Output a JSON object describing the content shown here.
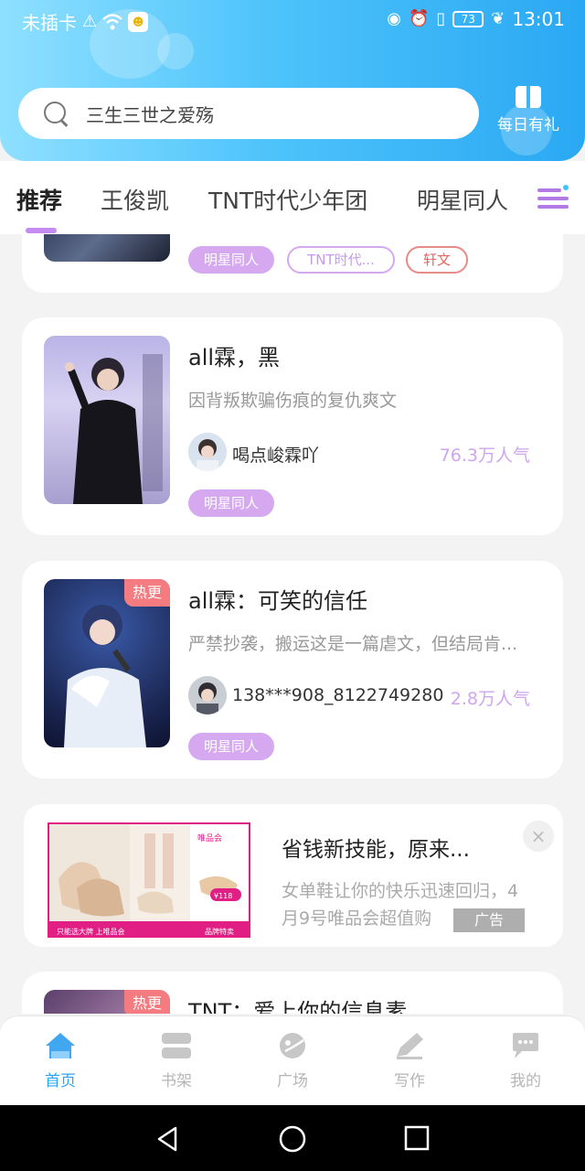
{
  "status_bar": {
    "carrier": "未插卡",
    "battery": "73",
    "time": "13:01"
  },
  "search": {
    "placeholder": "三生三世之爱殇"
  },
  "gift": {
    "label": "每日有礼"
  },
  "tabs": [
    {
      "label": "推荐",
      "active": true
    },
    {
      "label": "王俊凯",
      "active": false
    },
    {
      "label": "TNT时代少年团",
      "active": false
    },
    {
      "label": "明星同人",
      "active": false
    }
  ],
  "partial_card": {
    "tags": [
      "明星同人",
      "TNT时代...",
      "轩文"
    ]
  },
  "cards": [
    {
      "title": "all霖，黑",
      "desc": "因背叛欺骗伤痕的复仇爽文",
      "author": "喝点峻霖吖",
      "popularity": "76.3万人气",
      "tag": "明星同人",
      "hot": ""
    },
    {
      "title": "all霖：可笑的信任",
      "desc": "严禁抄袭，搬运这是一篇虐文，但结局肯...",
      "author": "138***908_8122749280",
      "popularity": "2.8万人气",
      "tag": "明星同人",
      "hot": "热更"
    }
  ],
  "ad": {
    "title": "省钱新技能，原来...",
    "desc": "女单鞋让你的快乐迅速回归，4月9号唯品会超值购",
    "label": "广告",
    "close": "×",
    "brand": "唯品会",
    "banner_left": "只能选大牌 上唯品会",
    "banner_right": "品牌特卖",
    "price": "¥118"
  },
  "bottom_card": {
    "title": "TNT：爱上你的信息素",
    "hot": "热更"
  },
  "nav": [
    {
      "label": "首页",
      "icon": "home-icon",
      "active": true
    },
    {
      "label": "书架",
      "icon": "bookshelf-icon",
      "active": false
    },
    {
      "label": "广场",
      "icon": "plaza-icon",
      "active": false
    },
    {
      "label": "写作",
      "icon": "write-icon",
      "active": false
    },
    {
      "label": "我的",
      "icon": "chat-profile-icon",
      "active": false
    }
  ],
  "colors": {
    "accent": "#2ea3f2",
    "tag_purple": "#d5a8f0",
    "hot_red": "#f47c80"
  }
}
